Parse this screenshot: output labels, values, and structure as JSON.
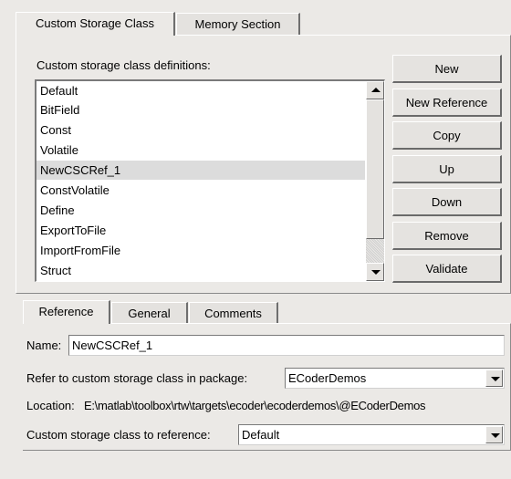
{
  "top_tabs": [
    {
      "label": "Custom Storage Class",
      "active": true
    },
    {
      "label": "Memory Section",
      "active": false
    }
  ],
  "definitions": {
    "label": "Custom storage class definitions:",
    "items": [
      "Default",
      "BitField",
      "Const",
      "Volatile",
      "NewCSCRef_1",
      "ConstVolatile",
      "Define",
      "ExportToFile",
      "ImportFromFile",
      "Struct"
    ],
    "selected_index": 4
  },
  "buttons": {
    "new": "New",
    "new_reference": "New Reference",
    "copy": "Copy",
    "up": "Up",
    "down": "Down",
    "remove": "Remove",
    "validate": "Validate"
  },
  "bottom_tabs": [
    {
      "label": "Reference",
      "active": true
    },
    {
      "label": "General",
      "active": false
    },
    {
      "label": "Comments",
      "active": false
    }
  ],
  "form": {
    "name_label": "Name:",
    "name_value": "NewCSCRef_1",
    "package_label": "Refer to custom storage class in package:",
    "package_value": "ECoderDemos",
    "location_label": "Location:",
    "location_value": "E:\\matlab\\toolbox\\rtw\\targets\\ecoder\\ecoderdemos\\@ECoderDemos",
    "csc_label": "Custom storage class to reference:",
    "csc_value": "Default"
  },
  "icons": {
    "scroll_up": "scroll-up-arrow-icon",
    "scroll_down": "scroll-down-arrow-icon",
    "dropdown": "chevron-down-icon"
  }
}
